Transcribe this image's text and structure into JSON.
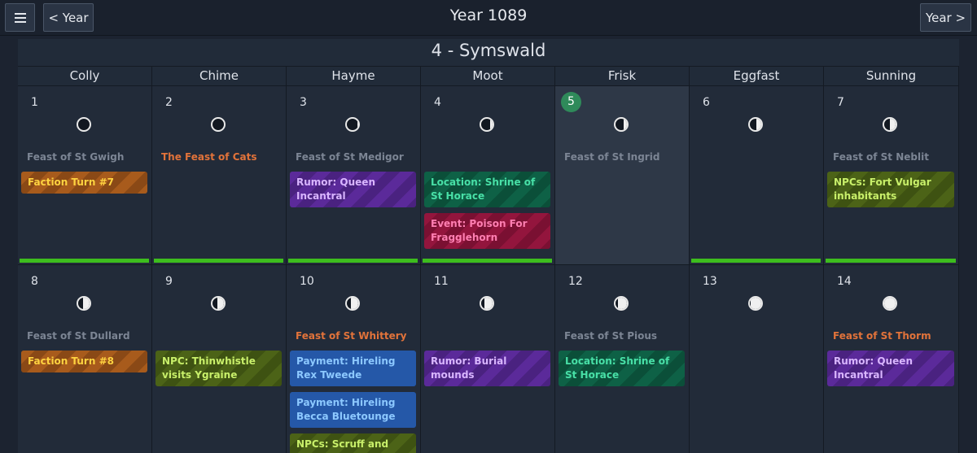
{
  "header": {
    "year_title": "Year 1089",
    "prev_label": "< Year",
    "next_label": "Year >",
    "menu_icon": "hamburger-menu-icon"
  },
  "month": {
    "title": "4 - Symswald"
  },
  "weekdays": [
    "Colly",
    "Chime",
    "Hayme",
    "Moot",
    "Frisk",
    "Eggfast",
    "Sunning"
  ],
  "today": 5,
  "weeks": [
    [
      {
        "day": "1",
        "moon": 0.0,
        "holiday": "Feast of St Gwigh",
        "holiday_color": "gray",
        "events": [
          {
            "label": "Faction Turn #7",
            "style": "orange"
          }
        ],
        "bar": true
      },
      {
        "day": "2",
        "moon": 0.03,
        "holiday": "The Feast of Cats",
        "holiday_color": "orange",
        "events": [],
        "bar": true
      },
      {
        "day": "3",
        "moon": 0.1,
        "holiday": "Feast of St Medigor",
        "holiday_color": "gray",
        "events": [
          {
            "label": "Rumor: Queen Incantral",
            "style": "purple"
          }
        ],
        "bar": true
      },
      {
        "day": "4",
        "moon": 0.2,
        "holiday": "",
        "holiday_color": "gray",
        "events": [
          {
            "label": "Location: Shrine of St Horace",
            "style": "teal"
          },
          {
            "label": "Event: Poison For Fragglehorn",
            "style": "crimson"
          }
        ],
        "bar": true
      },
      {
        "day": "5",
        "moon": 0.32,
        "holiday": "Feast of St Ingrid",
        "holiday_color": "gray",
        "events": [],
        "bar": false
      },
      {
        "day": "6",
        "moon": 0.42,
        "holiday": "",
        "holiday_color": "gray",
        "events": [],
        "bar": true
      },
      {
        "day": "7",
        "moon": 0.5,
        "holiday": "Feast of St Neblit",
        "holiday_color": "gray",
        "events": [
          {
            "label": "NPCs: Fort Vulgar inhabitants",
            "style": "olive"
          }
        ],
        "bar": true
      }
    ],
    [
      {
        "day": "8",
        "moon": 0.55,
        "holiday": "Feast of St Dullard",
        "holiday_color": "gray",
        "events": [
          {
            "label": "Faction Turn #8",
            "style": "orange"
          }
        ],
        "bar": false
      },
      {
        "day": "9",
        "moon": 0.6,
        "holiday": "",
        "holiday_color": "gray",
        "events": [
          {
            "label": "NPC: Thinwhistle visits Ygraine",
            "style": "olive"
          }
        ],
        "bar": false
      },
      {
        "day": "10",
        "moon": 0.65,
        "holiday": "Feast of St Whittery",
        "holiday_color": "orange",
        "events": [
          {
            "label": "Payment: Hireling Rex Tweede",
            "style": "blue"
          },
          {
            "label": "Payment: Hireling Becca Bluetounge",
            "style": "blue"
          },
          {
            "label": "NPCs: Scruff and Scripe",
            "style": "olive"
          }
        ],
        "bar": false
      },
      {
        "day": "11",
        "moon": 0.72,
        "holiday": "",
        "holiday_color": "gray",
        "events": [
          {
            "label": "Rumor: Burial mounds",
            "style": "purple"
          }
        ],
        "bar": false
      },
      {
        "day": "12",
        "moon": 0.8,
        "holiday": "Feast of St Pious",
        "holiday_color": "gray",
        "events": [
          {
            "label": "Location: Shrine of St Horace",
            "style": "teal"
          }
        ],
        "bar": false
      },
      {
        "day": "13",
        "moon": 0.92,
        "holiday": "",
        "holiday_color": "gray",
        "events": [],
        "bar": false
      },
      {
        "day": "14",
        "moon": 1.0,
        "holiday": "Feast of St Thorm",
        "holiday_color": "orange",
        "events": [
          {
            "label": "Rumor: Queen Incantral",
            "style": "purple"
          }
        ],
        "bar": false
      }
    ]
  ],
  "colors": {
    "accent_green": "#3dbd1e",
    "today_badge": "#2f8a5a"
  }
}
